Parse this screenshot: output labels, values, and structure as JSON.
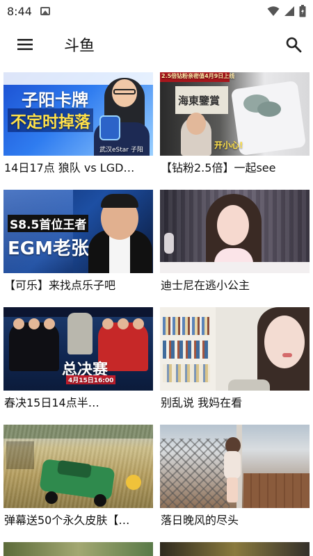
{
  "status_bar": {
    "time": "8:44"
  },
  "app_bar": {
    "title": "斗鱼",
    "menu_icon": "menu-icon",
    "search_icon": "search-icon"
  },
  "streams": [
    {
      "title": "14日17点 狼队 vs LGD…",
      "thumb_text": {
        "line1": "子阳卡牌",
        "line2": "不定时掉落",
        "small": "武汉eStar  子阳"
      }
    },
    {
      "title": "【钻粉2.5倍】一起see",
      "thumb_text": {
        "line1": "2.5倍钻粉亲密值4月9日上线",
        "line2": "海東鑒賞",
        "small": "开小心!"
      }
    },
    {
      "title": "【可乐】来找点乐子吧",
      "thumb_text": {
        "line1": "S8.5首位王者",
        "line2": "EGM老张"
      }
    },
    {
      "title": "迪士尼在逃小公主",
      "thumb_text": {}
    },
    {
      "title": "春决15日14点半…",
      "thumb_text": {
        "line1": "总决赛",
        "line2": "4月15日16:00"
      }
    },
    {
      "title": "别乱说 我妈在看",
      "thumb_text": {}
    },
    {
      "title": "弹幕送50个永久皮肤【…",
      "thumb_text": {}
    },
    {
      "title": "落日晚风的尽头",
      "thumb_text": {}
    }
  ],
  "colors": {
    "background": "#ffffff",
    "text": "#111111",
    "icon": "#222222"
  }
}
